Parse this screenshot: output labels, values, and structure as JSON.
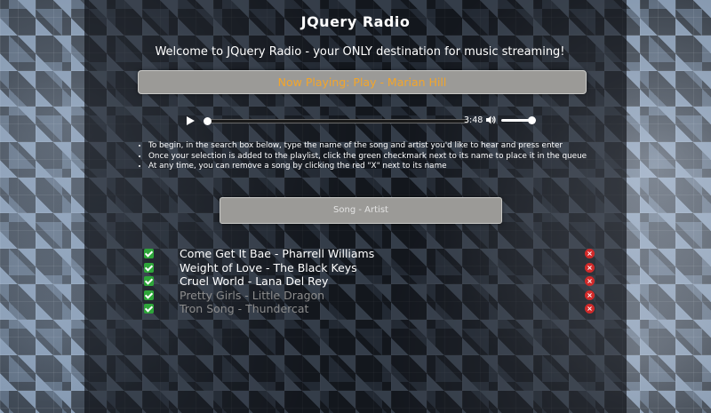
{
  "header": {
    "title": "JQuery Radio",
    "welcome": "Welcome to JQuery Radio - your ONLY destination for music streaming!"
  },
  "now_playing": {
    "text": "Now Playing: Play - Marian Hill"
  },
  "player": {
    "play_icon": "play-icon",
    "time": "3:48",
    "volume_icon": "volume-icon",
    "progress": 0.0,
    "volume": 0.85
  },
  "instructions": [
    "To begin, in the search box below, type the name of the song and artist you'd like to hear and press enter",
    "Once your selection is added to the playlist, click the green checkmark next to its name to place it in the queue",
    "At any time, you can remove a song by clicking the red \"X\" next to its name"
  ],
  "search": {
    "placeholder": "Song - Artist"
  },
  "playlist": [
    {
      "label": "Come Get It Bae - Pharrell Williams",
      "faded": false
    },
    {
      "label": "Weight of Love - The Black Keys",
      "faded": false
    },
    {
      "label": "Cruel World - Lana Del Rey",
      "faded": false
    },
    {
      "label": "Pretty Girls - Little Dragon",
      "faded": true
    },
    {
      "label": "Tron Song - Thundercat",
      "faded": true
    }
  ],
  "colors": {
    "accent": "#f3a52a",
    "check": "#2ea63a",
    "remove": "#d12a2a"
  }
}
